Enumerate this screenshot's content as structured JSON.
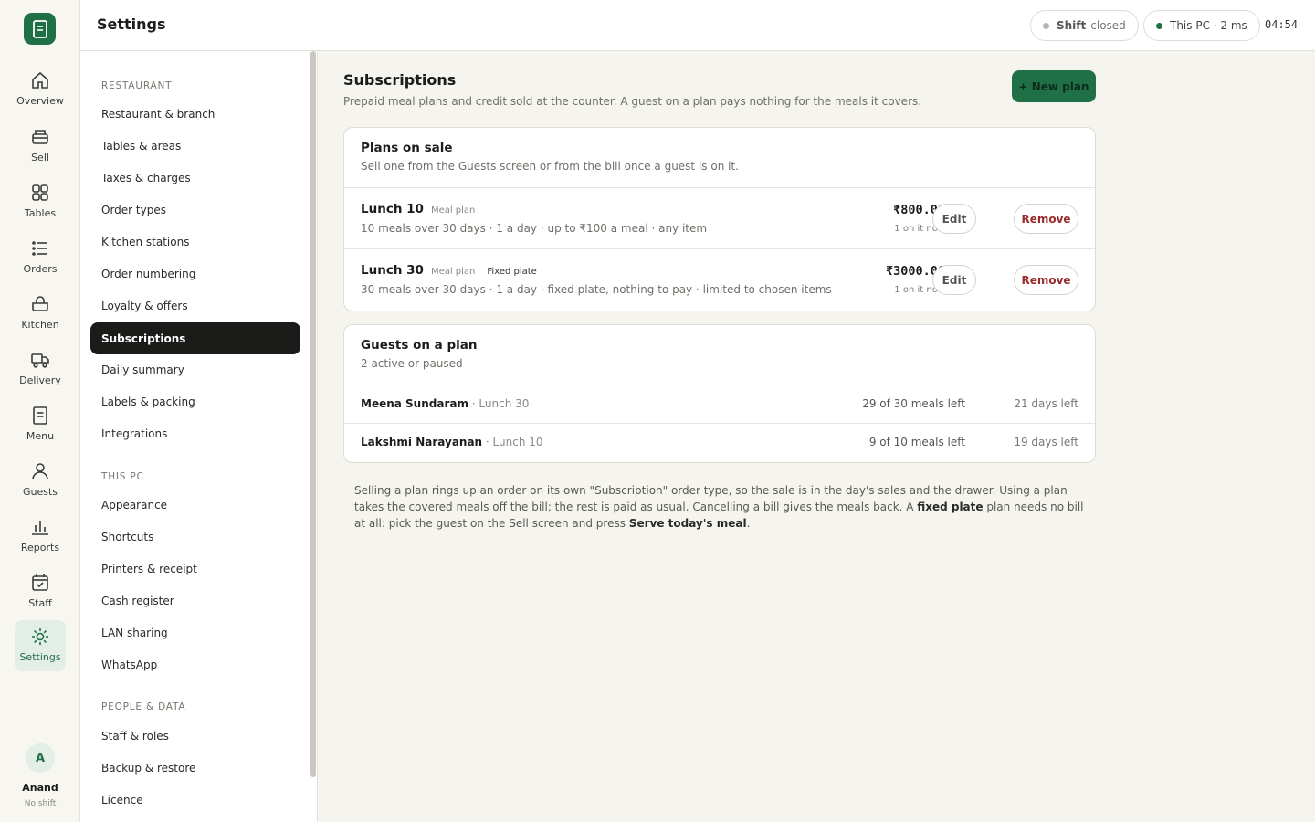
{
  "rail": {
    "items": [
      {
        "label": "Overview",
        "icon": "home-icon"
      },
      {
        "label": "Sell",
        "icon": "register-icon"
      },
      {
        "label": "Tables",
        "icon": "grid-icon"
      },
      {
        "label": "Orders",
        "icon": "list-icon"
      },
      {
        "label": "Kitchen",
        "icon": "pot-icon"
      },
      {
        "label": "Delivery",
        "icon": "truck-icon"
      },
      {
        "label": "Menu",
        "icon": "document-icon"
      },
      {
        "label": "Guests",
        "icon": "person-icon"
      },
      {
        "label": "Reports",
        "icon": "bar-chart-icon"
      },
      {
        "label": "Staff",
        "icon": "calendar-check-icon"
      },
      {
        "label": "Settings",
        "icon": "gear-icon"
      }
    ],
    "active": "Settings",
    "user": {
      "initial": "A",
      "name": "Anand",
      "status": "No shift"
    }
  },
  "topbar": {
    "title": "Settings",
    "shift_label": "Shift",
    "shift_status": "closed",
    "pc_status": "This PC · 2 ms",
    "time": "04:54"
  },
  "settings_nav": {
    "sections": [
      {
        "heading": "RESTAURANT",
        "items": [
          "Restaurant & branch",
          "Tables & areas",
          "Taxes & charges",
          "Order types",
          "Kitchen stations",
          "Order numbering",
          "Loyalty & offers",
          "Subscriptions",
          "Daily summary",
          "Labels & packing",
          "Integrations"
        ]
      },
      {
        "heading": "THIS PC",
        "items": [
          "Appearance",
          "Shortcuts",
          "Printers & receipt",
          "Cash register",
          "LAN sharing",
          "WhatsApp"
        ]
      },
      {
        "heading": "PEOPLE & DATA",
        "items": [
          "Staff & roles",
          "Backup & restore",
          "Licence"
        ]
      }
    ],
    "active": "Subscriptions"
  },
  "main": {
    "title": "Subscriptions",
    "subtitle": "Prepaid meal plans and credit sold at the counter. A guest on a plan pays nothing for the meals it covers.",
    "new_plan_label": "+ New plan",
    "plans_card": {
      "title": "Plans on sale",
      "subtitle": "Sell one from the Guests screen or from the bill once a guest is on it.",
      "plans": [
        {
          "name": "Lunch 10",
          "type": "Meal plan",
          "tag": "",
          "desc": "10 meals over 30 days · 1 a day · up to ₹100 a meal · any item",
          "price": "₹800.00",
          "count": "1 on it now"
        },
        {
          "name": "Lunch 30",
          "type": "Meal plan",
          "tag": "Fixed plate",
          "desc": "30 meals over 30 days · 1 a day · fixed plate, nothing to pay · limited to chosen items",
          "price": "₹3000.00",
          "count": "1 on it now"
        }
      ],
      "edit_label": "Edit",
      "remove_label": "Remove"
    },
    "guests_card": {
      "title": "Guests on a plan",
      "subtitle": "2 active or paused",
      "guests": [
        {
          "name": "Meena Sundaram",
          "plan": " · Lunch 30",
          "meals": "29 of 30 meals left",
          "days": "21 days left"
        },
        {
          "name": "Lakshmi Narayanan",
          "plan": " · Lunch 10",
          "meals": "9 of 10 meals left",
          "days": "19 days left"
        }
      ]
    },
    "note": {
      "part1": "Selling a plan rings up an order on its own \"Subscription\" order type, so the sale is in the day's sales and the drawer. Using a plan takes the covered meals off the bill; the rest is paid as usual. Cancelling a bill gives the meals back. A ",
      "bold1": "fixed plate",
      "part2": " plan needs no bill at all: pick the guest on the Sell screen and press ",
      "bold2": "Serve today's meal",
      "part3": "."
    }
  },
  "colors": {
    "accent": "#1f6f47",
    "danger": "#9a2b2b",
    "shift_dot": "#b5b3ab",
    "online_dot": "#1f6f47"
  }
}
